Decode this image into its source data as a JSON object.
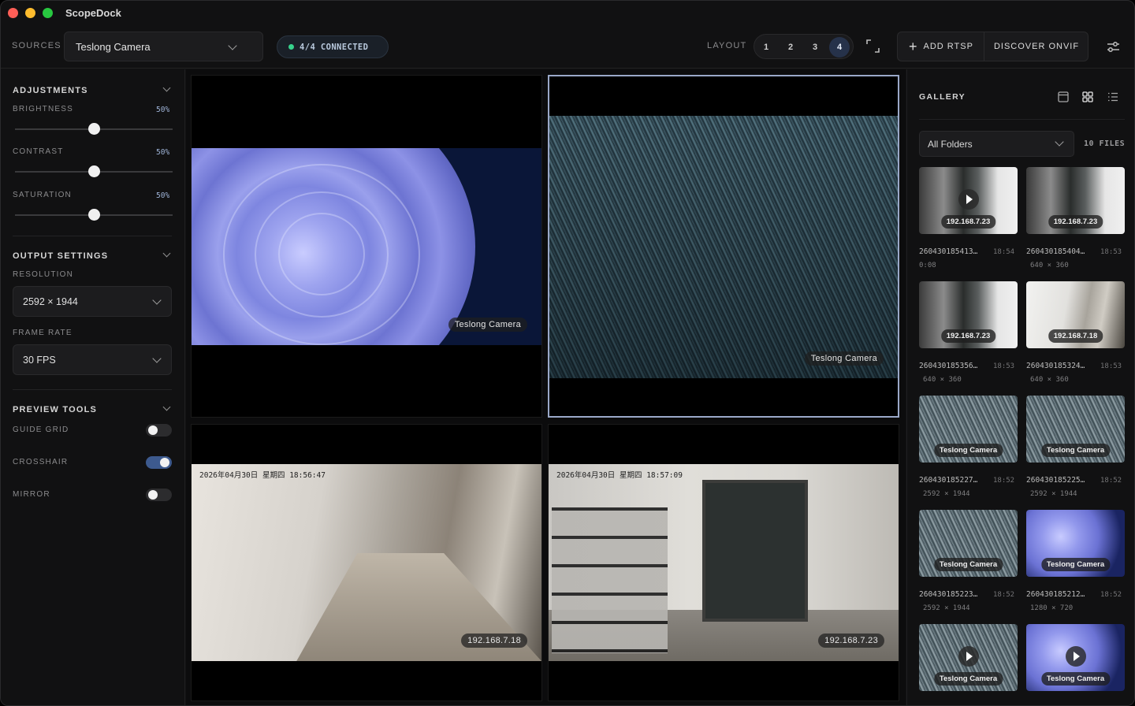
{
  "app": {
    "title": "ScopeDock"
  },
  "toolbar": {
    "sources_label": "SOURCES",
    "source_value": "Teslong Camera",
    "connection_status": "4/4 CONNECTED",
    "layout_label": "LAYOUT",
    "layout_options": [
      "1",
      "2",
      "3",
      "4"
    ],
    "layout_active": "4",
    "add_rtsp_label": "ADD RTSP",
    "discover_onvif_label": "DISCOVER ONVIF"
  },
  "sidebar": {
    "adjustments": {
      "title": "ADJUSTMENTS",
      "brightness": {
        "label": "BRIGHTNESS",
        "value": "50%",
        "level": 0.5
      },
      "contrast": {
        "label": "CONTRAST",
        "value": "50%",
        "level": 0.5
      },
      "saturation": {
        "label": "SATURATION",
        "value": "50%",
        "level": 0.5
      }
    },
    "output": {
      "title": "OUTPUT SETTINGS",
      "resolution_label": "RESOLUTION",
      "resolution_value": "2592 × 1944",
      "framerate_label": "FRAME RATE",
      "framerate_value": "30 FPS"
    },
    "preview": {
      "title": "PREVIEW TOOLS",
      "guide_grid": {
        "label": "GUIDE GRID",
        "on": false
      },
      "crosshair": {
        "label": "CROSSHAIR",
        "on": true
      },
      "mirror": {
        "label": "MIRROR",
        "on": false
      }
    }
  },
  "feeds": [
    {
      "tag": "Teslong Camera",
      "osd": "",
      "selected": false
    },
    {
      "tag": "Teslong Camera",
      "osd": "",
      "selected": true
    },
    {
      "tag": "192.168.7.18",
      "osd": "2026年04月30日 星期四 18:56:47",
      "selected": false
    },
    {
      "tag": "192.168.7.23",
      "osd": "2026年04月30日 星期四 18:57:09",
      "selected": false
    }
  ],
  "gallery": {
    "title": "GALLERY",
    "folder_value": "All Folders",
    "files_count": "10 FILES",
    "items": [
      {
        "tag": "192.168.7.23",
        "name": "260430185413…",
        "time": "18:54",
        "meta": "0:08",
        "video": true,
        "kind": "office"
      },
      {
        "tag": "192.168.7.23",
        "name": "260430185404…",
        "time": "18:53",
        "meta": "640 × 360",
        "video": false,
        "kind": "office"
      },
      {
        "tag": "192.168.7.23",
        "name": "260430185356…",
        "time": "18:53",
        "meta": "640 × 360",
        "video": false,
        "kind": "office"
      },
      {
        "tag": "192.168.7.18",
        "name": "260430185324…",
        "time": "18:53",
        "meta": "640 × 360",
        "video": false,
        "kind": "hallway"
      },
      {
        "tag": "Teslong Camera",
        "name": "260430185227…",
        "time": "18:52",
        "meta": "2592 × 1944",
        "video": false,
        "kind": "meshpic"
      },
      {
        "tag": "Teslong Camera",
        "name": "260430185225…",
        "time": "18:52",
        "meta": "2592 × 1944",
        "video": false,
        "kind": "meshpic"
      },
      {
        "tag": "Teslong Camera",
        "name": "260430185223…",
        "time": "18:52",
        "meta": "2592 × 1944",
        "video": false,
        "kind": "meshpic"
      },
      {
        "tag": "Teslong Camera",
        "name": "260430185212…",
        "time": "18:52",
        "meta": "1280 × 720",
        "video": false,
        "kind": "lenspic"
      },
      {
        "tag": "Teslong Camera",
        "name": "",
        "time": "",
        "meta": "",
        "video": true,
        "kind": "meshpic"
      },
      {
        "tag": "Teslong Camera",
        "name": "",
        "time": "",
        "meta": "",
        "video": true,
        "kind": "lenspic"
      }
    ]
  }
}
